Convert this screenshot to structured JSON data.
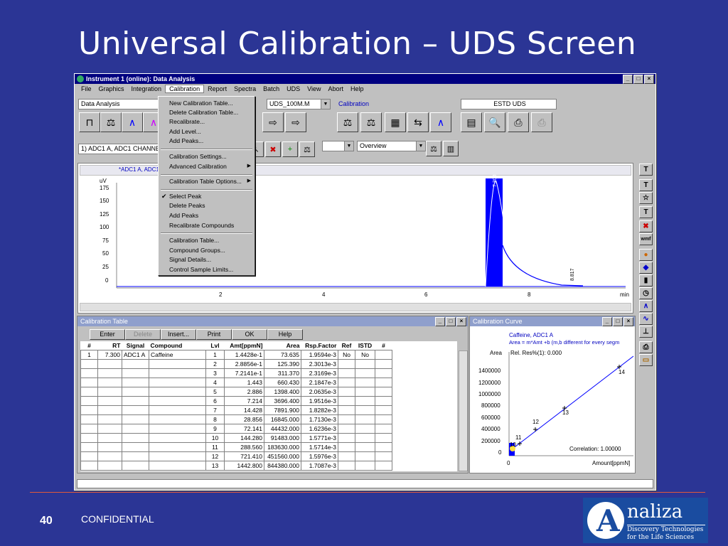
{
  "slide": {
    "title": "Universal Calibration – UDS Screen",
    "page_number": "40",
    "footer": "CONFIDENTIAL"
  },
  "logo": {
    "name_text": "naliza",
    "letter": "A",
    "tagline1": "Discovery Technologies",
    "tagline2": "for the Life Sciences"
  },
  "window": {
    "title": "Instrument 1 (online): Data Analysis",
    "min": "_",
    "max": "□",
    "close": "×"
  },
  "menubar": [
    "File",
    "Graphics",
    "Integration",
    "Calibration",
    "Report",
    "Spectra",
    "Batch",
    "UDS",
    "View",
    "Abort",
    "Help"
  ],
  "toolbar": {
    "view_combo": "Data Analysis",
    "method_combo": "UDS_100M.M",
    "calibration_label": "Calibration",
    "report_combo": "ESTD UDS",
    "signal_combo": "1) ADC1 A, ADC1 CHANNEL",
    "overview_combo": "Overview"
  },
  "calibration_menu": {
    "items": [
      "New Calibration Table...",
      "Delete Calibration Table...",
      "Recalibrate...",
      "Add Level...",
      "Add Peaks...",
      "Calibration Settings...",
      "Advanced Calibration",
      "Calibration Table Options...",
      "Select Peak",
      "Delete Peaks",
      "Add Peaks",
      "Recalibrate Compounds",
      "Calibration Table...",
      "Compound Groups...",
      "Signal Details...",
      "Control Sample Limits..."
    ],
    "submenu_arrow": "▶",
    "check": "✔"
  },
  "chromatogram": {
    "header": "*ADC1 A, ADC1",
    "y_unit": "uV",
    "y_ticks": [
      "175",
      "150",
      "125",
      "100",
      "75",
      "50",
      "25",
      "0"
    ],
    "x_ticks": [
      "2",
      "4",
      "6",
      "8"
    ],
    "x_unit": "min",
    "peak_label": "8.817",
    "peak_label_rt": "7.300"
  },
  "calibration_table": {
    "title": "Calibration Table",
    "buttons": [
      "Enter",
      "Delete",
      "Insert...",
      "Print",
      "OK",
      "Help"
    ],
    "columns": [
      "#",
      "RT",
      "Signal",
      "Compound",
      "Lvl",
      "Amt[ppmN]",
      "Area",
      "Rsp.Factor",
      "Ref",
      "ISTD",
      "#"
    ],
    "rows": [
      [
        "1",
        "7.300",
        "ADC1 A",
        "Caffeine",
        "1",
        "1.4428e-1",
        "73.635",
        "1.9594e-3",
        "No",
        "No",
        ""
      ],
      [
        "",
        "",
        "",
        "",
        "2",
        "2.8856e-1",
        "125.390",
        "2.3013e-3",
        "",
        "",
        ""
      ],
      [
        "",
        "",
        "",
        "",
        "3",
        "7.2141e-1",
        "311.370",
        "2.3169e-3",
        "",
        "",
        ""
      ],
      [
        "",
        "",
        "",
        "",
        "4",
        "1.443",
        "660.430",
        "2.1847e-3",
        "",
        "",
        ""
      ],
      [
        "",
        "",
        "",
        "",
        "5",
        "2.886",
        "1398.400",
        "2.0635e-3",
        "",
        "",
        ""
      ],
      [
        "",
        "",
        "",
        "",
        "6",
        "7.214",
        "3696.400",
        "1.9516e-3",
        "",
        "",
        ""
      ],
      [
        "",
        "",
        "",
        "",
        "7",
        "14.428",
        "7891.900",
        "1.8282e-3",
        "",
        "",
        ""
      ],
      [
        "",
        "",
        "",
        "",
        "8",
        "28.856",
        "16845.000",
        "1.7130e-3",
        "",
        "",
        ""
      ],
      [
        "",
        "",
        "",
        "",
        "9",
        "72.141",
        "44432.000",
        "1.6236e-3",
        "",
        "",
        ""
      ],
      [
        "",
        "",
        "",
        "",
        "10",
        "144.280",
        "91483.000",
        "1.5771e-3",
        "",
        "",
        ""
      ],
      [
        "",
        "",
        "",
        "",
        "11",
        "288.560",
        "183630.000",
        "1.5714e-3",
        "",
        "",
        ""
      ],
      [
        "",
        "",
        "",
        "",
        "12",
        "721.410",
        "451560.000",
        "1.5976e-3",
        "",
        "",
        ""
      ],
      [
        "",
        "",
        "",
        "",
        "13",
        "1442.800",
        "844380.000",
        "1.7087e-3",
        "",
        "",
        ""
      ]
    ]
  },
  "calibration_curve": {
    "title": "Calibration Curve",
    "compound": "Caffeine, ADC1 A",
    "equation": "Area = m*Amt +b (m,b different for every segm",
    "rel_res": "Rel. Res%(1): 0.000",
    "correlation": "Correlation: 1.00000",
    "y_label": "Area",
    "x_label": "Amount[ppmN]",
    "x_tick": "0",
    "y_ticks": [
      "1400000",
      "1200000",
      "1000000",
      "800000",
      "600000",
      "400000",
      "200000",
      "0"
    ],
    "point_labels": [
      "10",
      "11",
      "12",
      "13",
      "14"
    ]
  },
  "colors": {
    "accent": "#000080",
    "peak": "#0000ff",
    "background": "#2b3595"
  }
}
